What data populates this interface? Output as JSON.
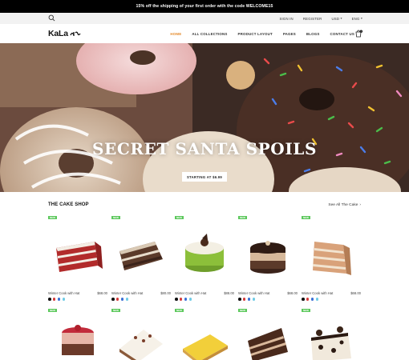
{
  "announcement": "15% off the shipping of your first order with the code WELCOME15",
  "utility": {
    "sign_in": "SIGN IN",
    "register": "REGISTER",
    "currency": "USD",
    "language": "ENG"
  },
  "nav": {
    "logo_text": "KaLa",
    "items": [
      {
        "label": "HOME",
        "active": true
      },
      {
        "label": "ALL COLLECTIONS",
        "active": false
      },
      {
        "label": "PRODUCT LAYOUT",
        "active": false
      },
      {
        "label": "PAGES",
        "active": false
      },
      {
        "label": "BLOGS",
        "active": false
      },
      {
        "label": "CONTACT US",
        "active": false
      }
    ],
    "cart_count": "0"
  },
  "hero": {
    "title": "SECRET SANTA SPOILS",
    "button": "STARTING AT $6.99"
  },
  "section": {
    "title": "THE CAKE SHOP",
    "see_all": "See All The Cake"
  },
  "colors": {
    "accent": "#e48a2b",
    "badge": "#5cc85c"
  },
  "products": [
    {
      "badge": "NEW",
      "name": "Winter Cook with Hat",
      "price": "$68.00",
      "icon": "red-velvet-cake-icon",
      "swatches": [
        "#111111",
        "#d63c3c",
        "#3b6fd6",
        "#6fcbe6"
      ]
    },
    {
      "badge": "NEW",
      "name": "Winter Cook with Hat",
      "price": "$80.00",
      "icon": "chocolate-layer-cake-icon",
      "swatches": [
        "#111111",
        "#d63c3c",
        "#3b6fd6",
        "#6fcbe6"
      ]
    },
    {
      "badge": "NEW",
      "name": "Winter Cook with Hat",
      "price": "$88.00",
      "icon": "matcha-mousse-icon",
      "swatches": [
        "#111111",
        "#d63c3c",
        "#3b6fd6",
        "#6fcbe6"
      ]
    },
    {
      "badge": "NEW",
      "name": "Winter Cook with Hat",
      "price": "$68.00",
      "icon": "mocha-mousse-icon",
      "swatches": [
        "#111111",
        "#d63c3c",
        "#3b6fd6",
        "#6fcbe6"
      ]
    },
    {
      "badge": "NEW",
      "name": "Winter Cook with Hat",
      "price": "$68.00",
      "icon": "caramel-layer-cake-icon",
      "swatches": [
        "#111111",
        "#d63c3c",
        "#3b6fd6",
        "#6fcbe6"
      ]
    },
    {
      "badge": "NEW",
      "name": "",
      "price": "",
      "icon": "strawberry-mousse-icon",
      "swatches": []
    },
    {
      "badge": "NEW",
      "name": "",
      "price": "",
      "icon": "cheesecake-slice-icon",
      "swatches": []
    },
    {
      "badge": "NEW",
      "name": "",
      "price": "",
      "icon": "lemon-tart-icon",
      "swatches": []
    },
    {
      "badge": "NEW",
      "name": "",
      "price": "",
      "icon": "chocolate-torte-icon",
      "swatches": []
    },
    {
      "badge": "NEW",
      "name": "",
      "price": "",
      "icon": "cookies-cream-cake-icon",
      "swatches": []
    }
  ]
}
